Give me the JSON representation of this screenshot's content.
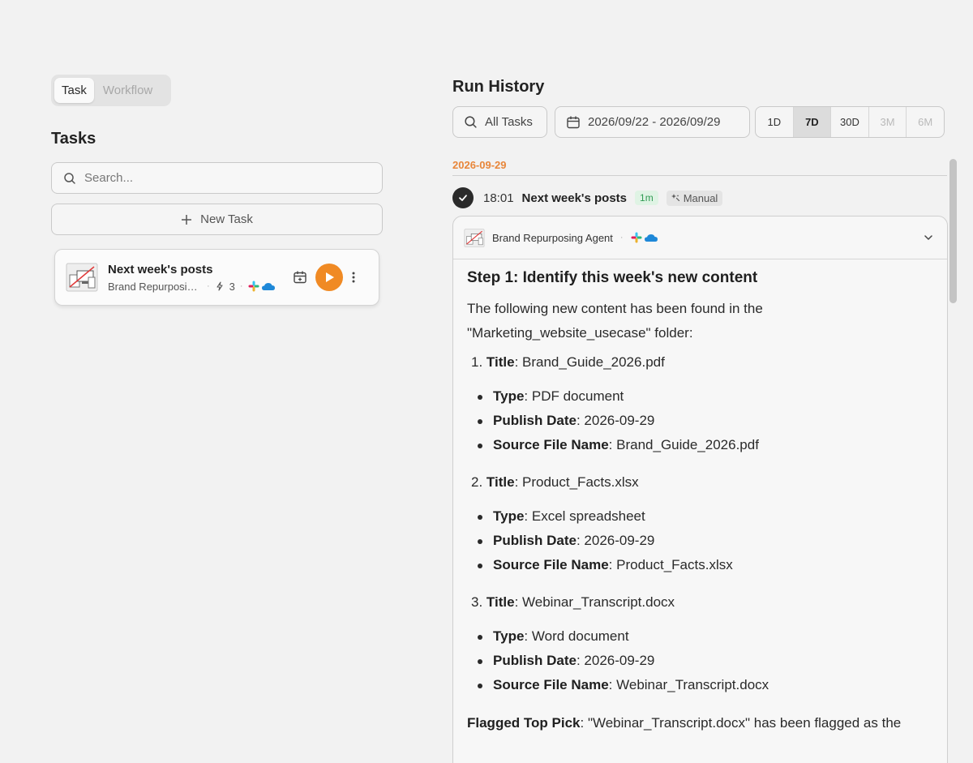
{
  "mode_toggle": {
    "task": "Task",
    "workflow": "Workflow"
  },
  "tasks_panel": {
    "title": "Tasks",
    "search_placeholder": "Search...",
    "new_task_label": "New Task",
    "items": [
      {
        "name": "Next week's posts",
        "subtitle": "Brand Repurposing Agent",
        "step_count": "3"
      }
    ]
  },
  "run_history": {
    "title": "Run History",
    "task_filter": "All Tasks",
    "date_range": "2026/09/22 - 2026/09/29",
    "ranges": [
      "1D",
      "7D",
      "30D",
      "3M",
      "6M"
    ],
    "active_range": "7D",
    "date_header": "2026-09-29",
    "run": {
      "time": "18:01",
      "name": "Next week's posts",
      "duration": "1m",
      "trigger": "Manual",
      "agent": "Brand Repurposing Agent",
      "step_title": "Step 1: Identify this week's new content",
      "intro": "The following new content has been found in the \"Marketing_website_usecase\" folder:",
      "labels": {
        "title": "Title",
        "type": "Type",
        "publish_date": "Publish Date",
        "source_file": "Source File Name"
      },
      "items": [
        {
          "num": "1.",
          "title": "Brand_Guide_2026.pdf",
          "type": "PDF document",
          "publish_date": "2026-09-29",
          "source": "Brand_Guide_2026.pdf"
        },
        {
          "num": "2.",
          "title": "Product_Facts.xlsx",
          "type": "Excel spreadsheet",
          "publish_date": "2026-09-29",
          "source": "Product_Facts.xlsx"
        },
        {
          "num": "3.",
          "title": "Webinar_Transcript.docx",
          "type": "Word document",
          "publish_date": "2026-09-29",
          "source": "Webinar_Transcript.docx"
        }
      ],
      "flag_label": "Flagged Top Pick",
      "flag_text": "\"Webinar_Transcript.docx\" has been flagged as the"
    }
  },
  "colors": {
    "accent_orange": "#f08a24",
    "date_orange": "#e8863a",
    "success_green": "#2f9a52",
    "background": "#f2f2f2"
  },
  "icons": {
    "search": "search-icon",
    "plus": "plus-icon",
    "calendar": "calendar-icon",
    "play": "play-icon",
    "more": "more-vertical-icon",
    "check": "check-icon",
    "chevron": "chevron-down-icon",
    "slack": "slack-icon",
    "cloud": "onedrive-icon",
    "sparkle": "sparkle-icon",
    "steps": "lightning-icon"
  }
}
